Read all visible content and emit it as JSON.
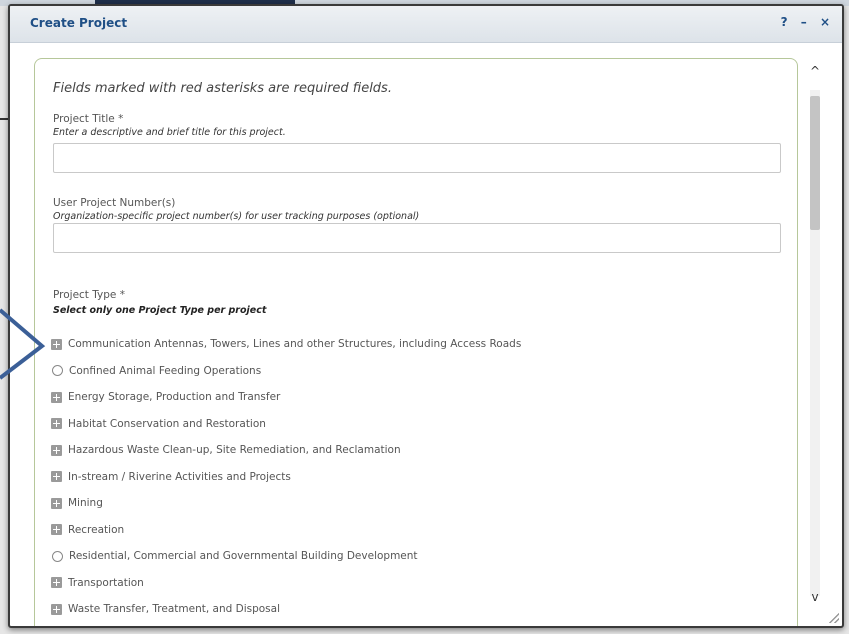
{
  "dialog": {
    "title": "Create Project",
    "controls": {
      "help": "?",
      "minimize": "–",
      "close": "×"
    }
  },
  "form": {
    "required_note": "Fields marked with red asterisks are required fields.",
    "project_title": {
      "label": "Project Title *",
      "hint": "Enter a descriptive and brief title for this project.",
      "value": "",
      "placeholder": ""
    },
    "user_project_number": {
      "label": "User Project Number(s)",
      "hint": "Organization-specific project number(s) for user tracking purposes (optional)",
      "value": "",
      "placeholder": ""
    },
    "project_type": {
      "label": "Project Type *",
      "hint": "Select only one Project Type per project",
      "items": [
        {
          "label": "Communication Antennas, Towers, Lines and other Structures, including Access Roads",
          "control": "expand"
        },
        {
          "label": "Confined Animal Feeding Operations",
          "control": "radio"
        },
        {
          "label": "Energy Storage, Production and Transfer",
          "control": "expand"
        },
        {
          "label": "Habitat Conservation and Restoration",
          "control": "expand"
        },
        {
          "label": "Hazardous Waste Clean-up, Site Remediation, and Reclamation",
          "control": "expand"
        },
        {
          "label": "In-stream / Riverine Activities and Projects",
          "control": "expand"
        },
        {
          "label": "Mining",
          "control": "expand"
        },
        {
          "label": "Recreation",
          "control": "expand"
        },
        {
          "label": "Residential, Commercial and Governmental Building Development",
          "control": "radio"
        },
        {
          "label": "Transportation",
          "control": "expand"
        },
        {
          "label": "Waste Transfer, Treatment, and Disposal",
          "control": "expand"
        }
      ]
    }
  },
  "colors": {
    "title_text": "#1f4f86",
    "panel_border": "#b6c79a",
    "callout_arrow": "#3b5f97"
  }
}
